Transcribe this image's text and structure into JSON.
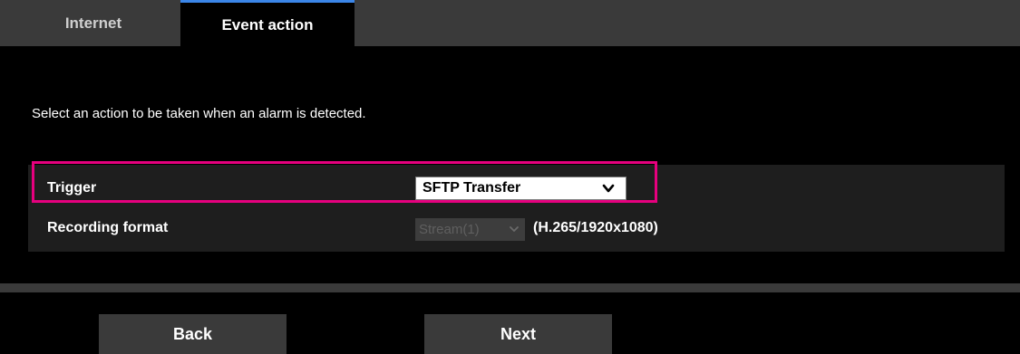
{
  "tabs": [
    {
      "label": "Internet",
      "active": false
    },
    {
      "label": "Event action",
      "active": true
    }
  ],
  "instruction": "Select an action to be taken when an alarm is detected.",
  "settings": {
    "trigger": {
      "label": "Trigger",
      "value": "SFTP Transfer",
      "highlighted": true
    },
    "recording_format": {
      "label": "Recording format",
      "value": "Stream(1)",
      "disabled": true,
      "detail": "(H.265/1920x1080)"
    }
  },
  "buttons": {
    "back": "Back",
    "next": "Next"
  },
  "icons": {
    "dropdown": "chevron-down-icon"
  },
  "colors": {
    "highlight": "#e6007e",
    "active_tab_accent": "#3b86e8",
    "background": "#000000",
    "panel": "#1e1e1e",
    "chrome": "#3a3a3a"
  }
}
